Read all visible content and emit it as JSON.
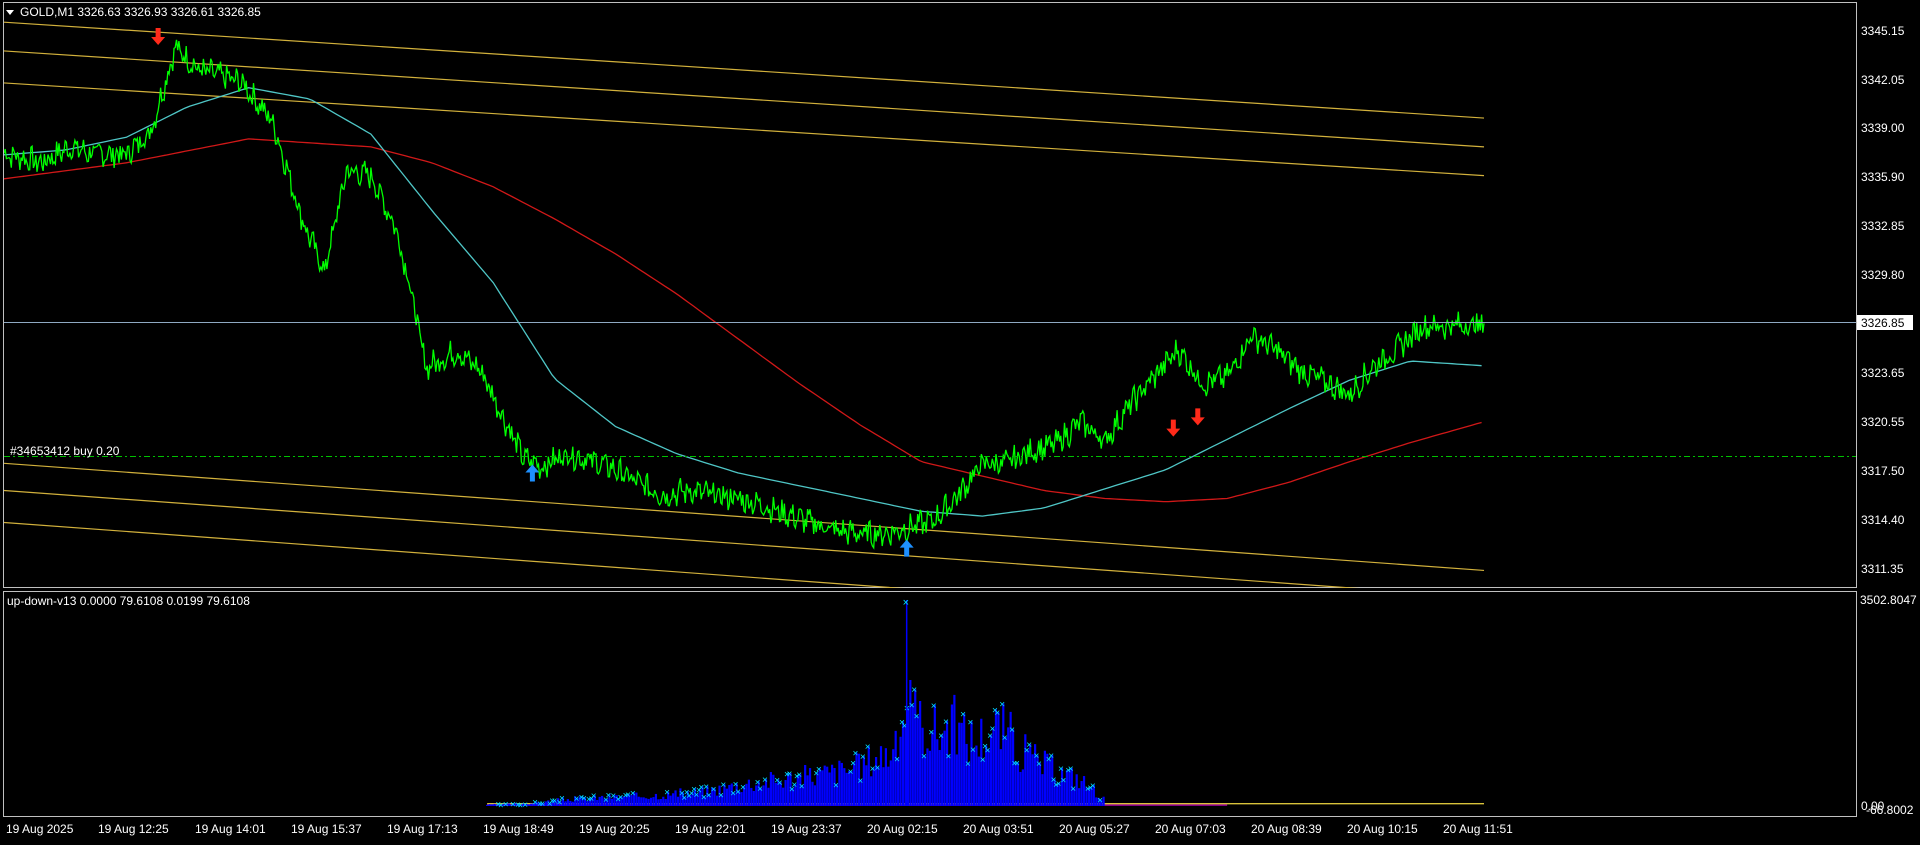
{
  "main_panel": {
    "symbol_header": "GOLD,M1  3326.63 3326.93 3326.61 3326.85",
    "position_label": "#34653412 buy 0.20",
    "current_price_label": "3326.85",
    "price_axis_labels": [
      "3345.15",
      "3342.05",
      "3339.00",
      "3335.90",
      "3332.85",
      "3329.80",
      "3326.85",
      "3323.65",
      "3320.55",
      "3317.50",
      "3314.40",
      "3311.35"
    ],
    "position_price": 3318.4,
    "current_price": 3326.85
  },
  "indicator_panel": {
    "header": "up-down-v13 0.0000 79.6108 0.0199 79.6108",
    "axis_top": "3502.8047",
    "axis_bottom_a": "0.00",
    "axis_bottom_b": "-66.8002"
  },
  "time_axis_labels": [
    "19 Aug 2025",
    "19 Aug 12:25",
    "19 Aug 14:01",
    "19 Aug 15:37",
    "19 Aug 17:13",
    "19 Aug 18:49",
    "19 Aug 20:25",
    "19 Aug 22:01",
    "19 Aug 23:37",
    "20 Aug 02:15",
    "20 Aug 03:51",
    "20 Aug 05:27",
    "20 Aug 07:03",
    "20 Aug 08:39",
    "20 Aug 10:15",
    "20 Aug 11:51"
  ],
  "colors": {
    "background": "#000000",
    "price_line": "#00ff00",
    "ma_fast": "#4fc6c6",
    "ma_slow": "#d01818",
    "channel": "#d2b13c",
    "buy_arrow": "#1e90ff",
    "sell_arrow": "#ff2a1a",
    "histogram": "#0000ff",
    "markers": "#00e5ff",
    "grid_line": "#c0c0c0",
    "order_line": "#00c000"
  },
  "chart_data": {
    "type": "line",
    "title": "",
    "price_range": [
      3310.4,
      3347.0
    ],
    "series": [
      {
        "name": "",
        "role": "price",
        "x_index": [
          0,
          30,
          55,
          70,
          100,
          120,
          140,
          160,
          175,
          195,
          220,
          245,
          262,
          280,
          300,
          320,
          330,
          345,
          370,
          390,
          410,
          425,
          440,
          460,
          480,
          500,
          520,
          540,
          560,
          580,
          600,
          620,
          640,
          660,
          680,
          700,
          720,
          740,
          760,
          780,
          800,
          820,
          840,
          860,
          880,
          900,
          920,
          940,
          960,
          980,
          1000,
          1020,
          1040,
          1060,
          1080,
          1100,
          1120,
          1140,
          1160,
          1180,
          1210
        ],
        "values": [
          3337.6,
          3337.0,
          3338.0,
          3337.6,
          3337.5,
          3339.0,
          3344.2,
          3342.8,
          3342.5,
          3342.0,
          3339.5,
          3333.2,
          3330.2,
          3336.5,
          3336.2,
          3333.0,
          3330.0,
          3324.2,
          3325.2,
          3324.0,
          3320.8,
          3318.5,
          3318.0,
          3318.8,
          3318.4,
          3317.8,
          3316.9,
          3316.2,
          3316.5,
          3316.2,
          3316.0,
          3315.6,
          3315.0,
          3314.5,
          3314.0,
          3313.8,
          3313.8,
          3314.2,
          3314.6,
          3316.2,
          3318.2,
          3318.2,
          3319.0,
          3319.4,
          3320.8,
          3319.6,
          3321.8,
          3323.6,
          3325.3,
          3323.2,
          3323.6,
          3326.2,
          3325.3,
          3324.0,
          3323.3,
          3322.5,
          3324.3,
          3325.4,
          3326.8,
          3326.8,
          3326.85
        ]
      },
      {
        "name": "",
        "role": "ma_fast",
        "x_index": [
          0,
          50,
          100,
          150,
          200,
          250,
          300,
          350,
          400,
          450,
          500,
          550,
          600,
          650,
          700,
          750,
          800,
          850,
          900,
          950,
          1000,
          1050,
          1100,
          1150,
          1210
        ],
        "values": [
          3337.5,
          3337.8,
          3338.6,
          3340.5,
          3341.7,
          3341.0,
          3338.8,
          3334.0,
          3329.5,
          3323.5,
          3320.5,
          3318.8,
          3317.6,
          3316.8,
          3316.0,
          3315.2,
          3314.9,
          3315.4,
          3316.6,
          3317.8,
          3319.7,
          3321.6,
          3323.4,
          3324.6,
          3324.3
        ]
      },
      {
        "name": "",
        "role": "ma_slow",
        "x_index": [
          0,
          100,
          200,
          300,
          350,
          400,
          450,
          500,
          550,
          600,
          650,
          700,
          750,
          800,
          850,
          900,
          950,
          1000,
          1050,
          1100,
          1150,
          1210
        ],
        "values": [
          3336.0,
          3337.0,
          3338.5,
          3338.0,
          3337.0,
          3335.5,
          3333.5,
          3331.3,
          3328.8,
          3326.0,
          3323.2,
          3320.6,
          3318.3,
          3317.4,
          3316.5,
          3316.0,
          3315.8,
          3316.0,
          3317.0,
          3318.3,
          3319.5,
          3320.8
        ]
      }
    ],
    "channel_lines": [
      {
        "start": 3345.8,
        "end": 3339.8
      },
      {
        "start": 3344.0,
        "end": 3338.0
      },
      {
        "start": 3342.0,
        "end": 3336.2
      },
      {
        "start": 3318.2,
        "end": 3311.5
      },
      {
        "start": 3316.5,
        "end": 3309.8
      },
      {
        "start": 3314.5,
        "end": 3307.7
      }
    ],
    "signals": [
      {
        "type": "sell",
        "x_index": 126,
        "price": 3345.0
      },
      {
        "type": "buy",
        "x_index": 432,
        "price": 3317.5
      },
      {
        "type": "buy",
        "x_index": 738,
        "price": 3312.8
      },
      {
        "type": "sell",
        "x_index": 956,
        "price": 3320.5
      },
      {
        "type": "sell",
        "x_index": 976,
        "price": 3321.2
      }
    ],
    "indicator_histogram": {
      "x_index": [
        395,
        430,
        460,
        480,
        500,
        520,
        540,
        560,
        580,
        600,
        620,
        640,
        660,
        680,
        700,
        710,
        720,
        730,
        737,
        738,
        739,
        745,
        755,
        765,
        775,
        785,
        795,
        805,
        812,
        820,
        830,
        840,
        860,
        880,
        890,
        900,
        920,
        960,
        1000,
        1100,
        1210
      ],
      "values": [
        30,
        60,
        150,
        180,
        210,
        230,
        260,
        300,
        360,
        480,
        560,
        620,
        700,
        780,
        900,
        1100,
        1200,
        1250,
        2400,
        3502,
        2400,
        1900,
        1800,
        1700,
        1900,
        1600,
        1500,
        1700,
        1800,
        1700,
        1300,
        1100,
        800,
        600,
        400,
        150,
        60,
        40,
        30,
        40,
        60
      ]
    },
    "indicator_range": [
      -66.8002,
      3502.8047
    ]
  }
}
